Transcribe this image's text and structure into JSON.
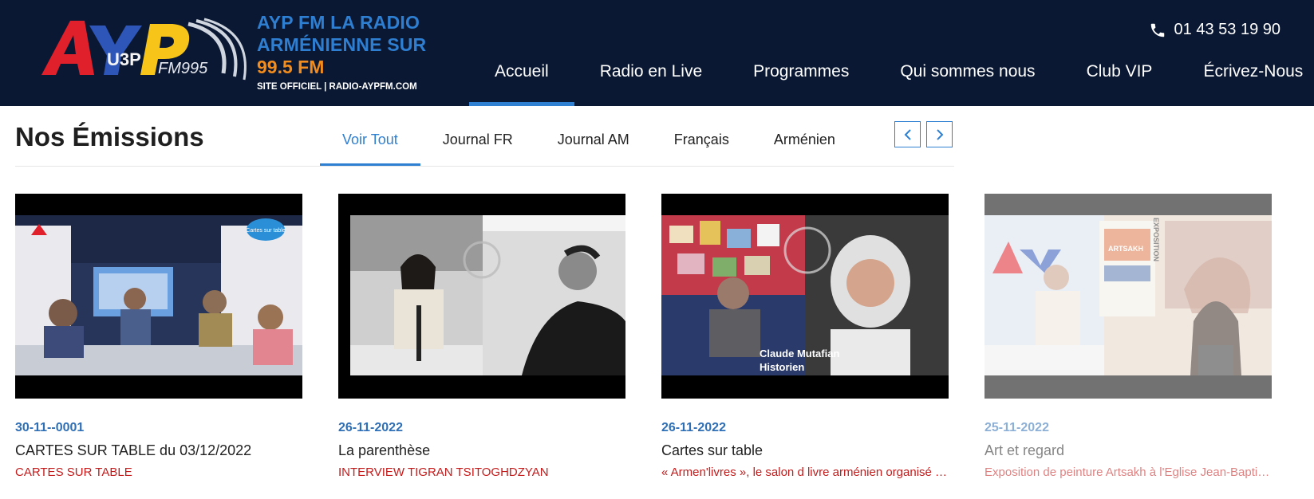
{
  "brand": {
    "line1": "AYP FM LA RADIO",
    "line2": "ARMÉNIENNE SUR",
    "freq": "99.5 FM",
    "site": "SITE OFFICIEL | RADIO-AYPFM.COM",
    "logo_text": "AYP FM 99.5"
  },
  "header": {
    "phone": "01 43 53 19 90"
  },
  "nav": {
    "items": [
      {
        "label": "Accueil",
        "active": true
      },
      {
        "label": "Radio en Live"
      },
      {
        "label": "Programmes"
      },
      {
        "label": "Qui sommes nous"
      },
      {
        "label": "Club VIP"
      },
      {
        "label": "Écrivez-Nous"
      }
    ]
  },
  "section": {
    "title": "Nos Émissions",
    "tabs": [
      {
        "label": "Voir Tout",
        "active": true
      },
      {
        "label": "Journal FR"
      },
      {
        "label": "Journal AM"
      },
      {
        "label": "Français"
      },
      {
        "label": "Arménien"
      }
    ]
  },
  "cards": [
    {
      "date": "30-11--0001",
      "title": "CARTES SUR TABLE du 03/12/2022",
      "subtitle": "CARTES SUR TABLE"
    },
    {
      "date": "26-11-2022",
      "title": "La parenthèse",
      "subtitle": "INTERVIEW TIGRAN TSITOGHDZYAN"
    },
    {
      "date": "26-11-2022",
      "title": "Cartes sur table",
      "subtitle": "« Armen'livres », le salon d livre arménien organisé par"
    },
    {
      "date": "25-11-2022",
      "title": "Art et regard",
      "subtitle": "Exposition de peinture Artsakh à l'Eglise Jean-Baptiste"
    }
  ],
  "thumb_captions": {
    "card0_badge": "Cartes sur table",
    "card2_name": "Claude Mutafian",
    "card2_role": "Historien",
    "card3_poster": "ARTSAKH",
    "card3_vertical": "EXPOSITION"
  },
  "colors": {
    "header_bg": "#0b1833",
    "brand_blue": "#2e7ed1",
    "brand_orange": "#f28c1c",
    "accent": "#2f7fd2",
    "date_blue": "#2f6fb6",
    "subtitle_red": "#c41c1c"
  },
  "icons": [
    "phone-icon",
    "chevron-left-icon",
    "chevron-right-icon",
    "play-icon"
  ]
}
